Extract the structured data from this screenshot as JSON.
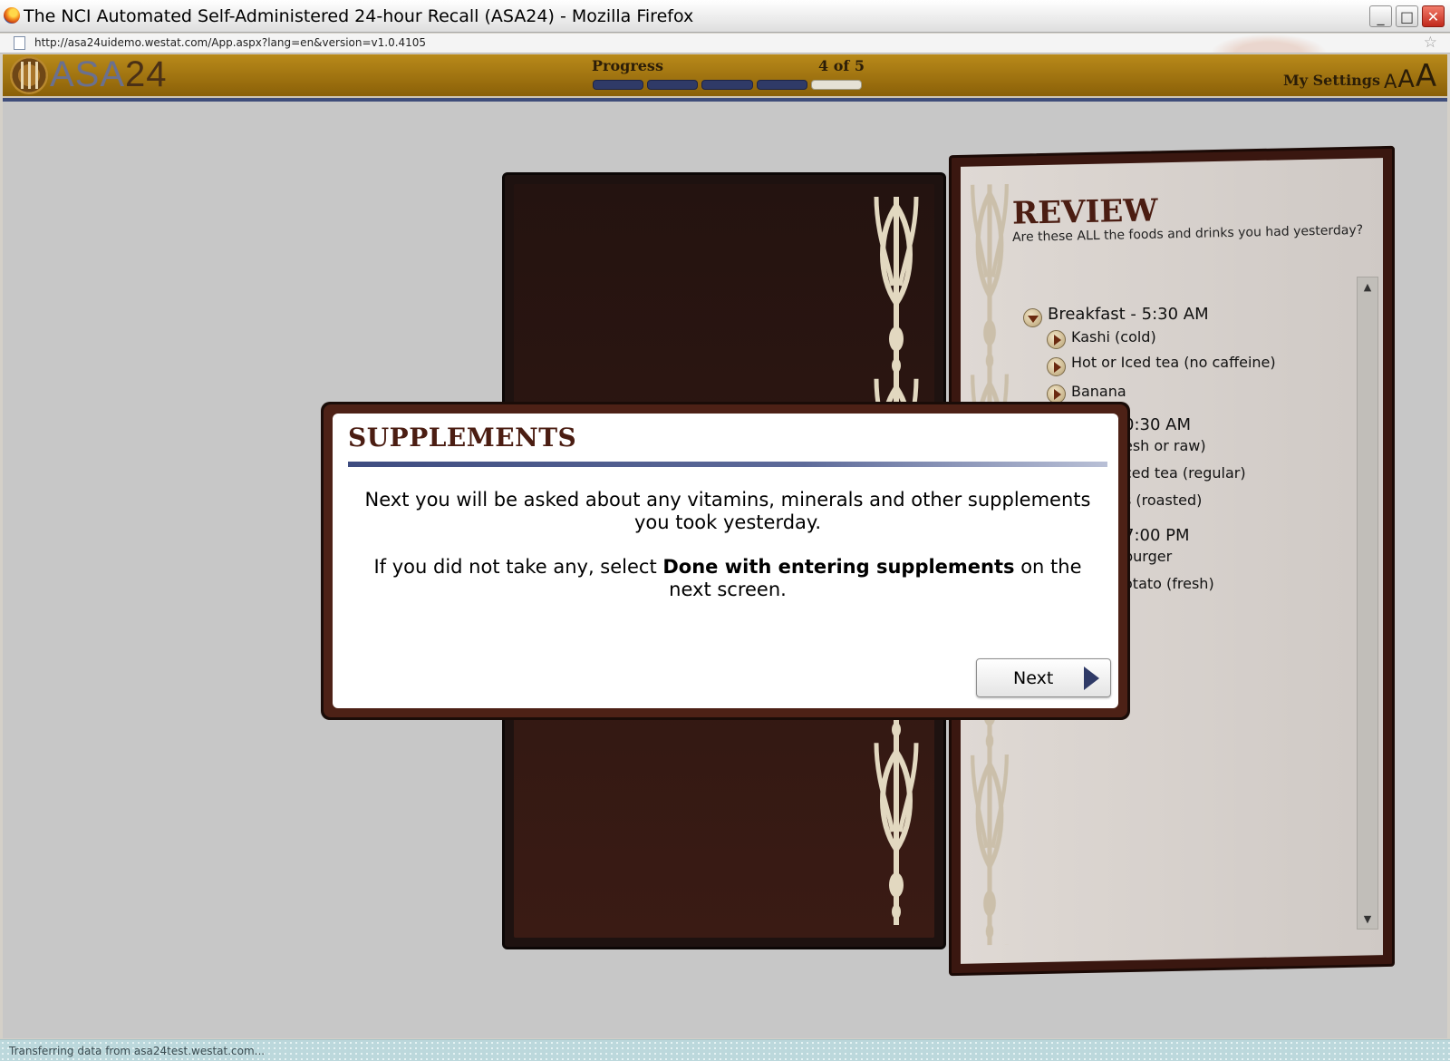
{
  "window": {
    "title": "The NCI Automated Self-Administered 24-hour Recall (ASA24) - Mozilla Firefox",
    "url": "http://asa24uidemo.westat.com/App.aspx?lang=en&version=v1.0.4105",
    "status": "Transferring data from asa24test.westat.com..."
  },
  "header": {
    "logo_prefix": "ASA",
    "logo_suffix": "24",
    "progress_label": "Progress",
    "progress_count": "4 of 5",
    "progress": {
      "completed": 4,
      "total": 5
    },
    "settings_label": "My Settings",
    "font_sizes": [
      "A",
      "A",
      "A"
    ]
  },
  "review": {
    "title": "REVIEW",
    "subtitle": "Are these ALL the foods and drinks you had yesterday?",
    "meals": [
      {
        "heading": "Breakfast - 5:30 AM",
        "items": [
          "Kashi (cold)",
          "Hot or Iced tea (no caffeine)",
          "Banana"
        ]
      },
      {
        "heading": "0:30 AM",
        "items": [
          "esh or raw)",
          "ced tea (regular)",
          "s (roasted)"
        ]
      },
      {
        "heading": "7:00 PM",
        "items": [
          "burger",
          "otato (fresh)"
        ]
      }
    ]
  },
  "dialog": {
    "title": "SUPPLEMENTS",
    "paragraph1": "Next you will be asked about any vitamins, minerals and other supplements you took yesterday.",
    "paragraph2_before": "If you did not take any, select ",
    "paragraph2_bold": "Done with entering supplements",
    "paragraph2_after": " on the next screen.",
    "next_label": "Next"
  },
  "colors": {
    "header_gold": "#9a6d0c",
    "menu_maroon": "#3a1710",
    "accent_navy": "#2f3a67",
    "title_maroon": "#4b1d12"
  }
}
